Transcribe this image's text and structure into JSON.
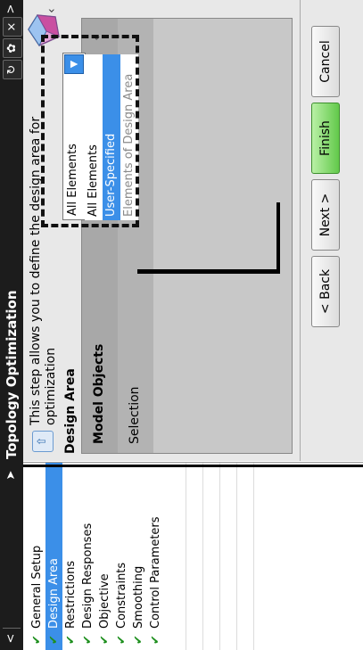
{
  "titlebar": {
    "title": "Topology Optimization",
    "left_chevron": "<",
    "right_chevron": ">",
    "refresh_icon_glyph": "↻",
    "gear_icon_glyph": "✿",
    "close_icon_glyph": "×"
  },
  "steps": [
    {
      "label": "General Setup",
      "done": true,
      "active": false
    },
    {
      "label": "Design Area",
      "done": true,
      "active": true
    },
    {
      "label": "Restrictions",
      "done": true,
      "active": false
    },
    {
      "label": "Design Responses",
      "done": true,
      "active": false
    },
    {
      "label": "Objective",
      "done": true,
      "active": false
    },
    {
      "label": "Constraints",
      "done": true,
      "active": false
    },
    {
      "label": "Smoothing",
      "done": true,
      "active": false
    },
    {
      "label": "Control Parameters",
      "done": true,
      "active": false
    }
  ],
  "info_text": "This step allows you to define the design area for optimization",
  "section": {
    "title": "Design Area",
    "group_header": "Model Objects",
    "row_label": "Selection"
  },
  "dropdown": {
    "selected": "All Elements",
    "options": [
      "All Elements",
      "User-Specified",
      "Elements of Design Area"
    ]
  },
  "buttons": {
    "back": "< Back",
    "next": "Next >",
    "finish": "Finish",
    "cancel": "Cancel"
  },
  "colors": {
    "accent": "#3b8fe8",
    "check": "#1e8f1e",
    "finish": "#62c94a",
    "titlebar": "#1c1c1c"
  }
}
